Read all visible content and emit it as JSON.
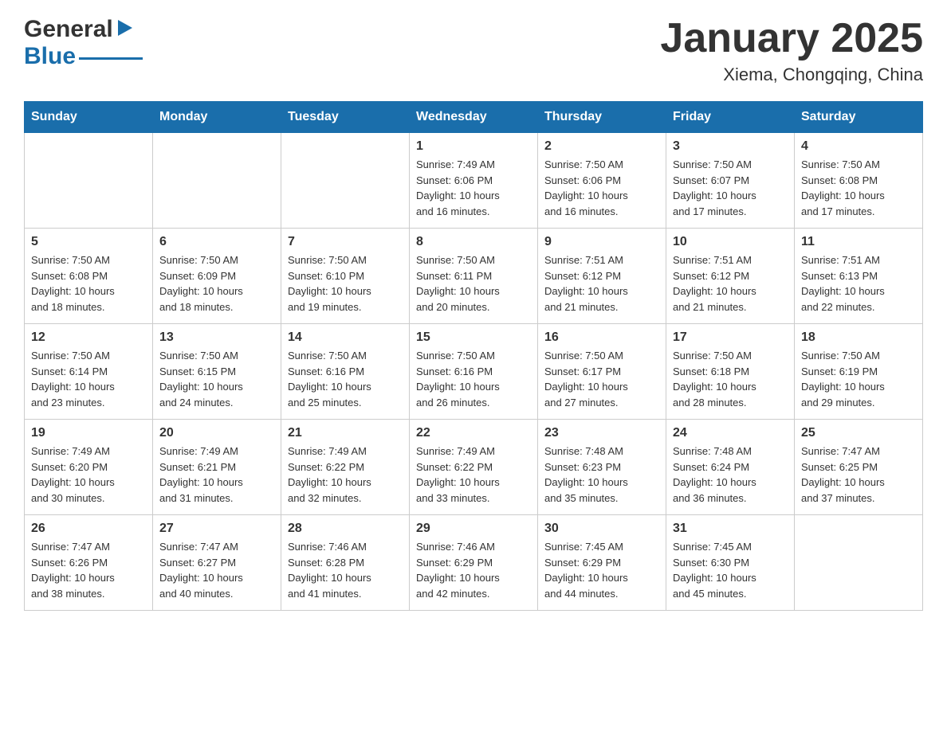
{
  "header": {
    "logo_general": "General",
    "logo_blue": "Blue",
    "title": "January 2025",
    "subtitle": "Xiema, Chongqing, China"
  },
  "days_of_week": [
    "Sunday",
    "Monday",
    "Tuesday",
    "Wednesday",
    "Thursday",
    "Friday",
    "Saturday"
  ],
  "weeks": [
    [
      {
        "day": "",
        "info": ""
      },
      {
        "day": "",
        "info": ""
      },
      {
        "day": "",
        "info": ""
      },
      {
        "day": "1",
        "info": "Sunrise: 7:49 AM\nSunset: 6:06 PM\nDaylight: 10 hours\nand 16 minutes."
      },
      {
        "day": "2",
        "info": "Sunrise: 7:50 AM\nSunset: 6:06 PM\nDaylight: 10 hours\nand 16 minutes."
      },
      {
        "day": "3",
        "info": "Sunrise: 7:50 AM\nSunset: 6:07 PM\nDaylight: 10 hours\nand 17 minutes."
      },
      {
        "day": "4",
        "info": "Sunrise: 7:50 AM\nSunset: 6:08 PM\nDaylight: 10 hours\nand 17 minutes."
      }
    ],
    [
      {
        "day": "5",
        "info": "Sunrise: 7:50 AM\nSunset: 6:08 PM\nDaylight: 10 hours\nand 18 minutes."
      },
      {
        "day": "6",
        "info": "Sunrise: 7:50 AM\nSunset: 6:09 PM\nDaylight: 10 hours\nand 18 minutes."
      },
      {
        "day": "7",
        "info": "Sunrise: 7:50 AM\nSunset: 6:10 PM\nDaylight: 10 hours\nand 19 minutes."
      },
      {
        "day": "8",
        "info": "Sunrise: 7:50 AM\nSunset: 6:11 PM\nDaylight: 10 hours\nand 20 minutes."
      },
      {
        "day": "9",
        "info": "Sunrise: 7:51 AM\nSunset: 6:12 PM\nDaylight: 10 hours\nand 21 minutes."
      },
      {
        "day": "10",
        "info": "Sunrise: 7:51 AM\nSunset: 6:12 PM\nDaylight: 10 hours\nand 21 minutes."
      },
      {
        "day": "11",
        "info": "Sunrise: 7:51 AM\nSunset: 6:13 PM\nDaylight: 10 hours\nand 22 minutes."
      }
    ],
    [
      {
        "day": "12",
        "info": "Sunrise: 7:50 AM\nSunset: 6:14 PM\nDaylight: 10 hours\nand 23 minutes."
      },
      {
        "day": "13",
        "info": "Sunrise: 7:50 AM\nSunset: 6:15 PM\nDaylight: 10 hours\nand 24 minutes."
      },
      {
        "day": "14",
        "info": "Sunrise: 7:50 AM\nSunset: 6:16 PM\nDaylight: 10 hours\nand 25 minutes."
      },
      {
        "day": "15",
        "info": "Sunrise: 7:50 AM\nSunset: 6:16 PM\nDaylight: 10 hours\nand 26 minutes."
      },
      {
        "day": "16",
        "info": "Sunrise: 7:50 AM\nSunset: 6:17 PM\nDaylight: 10 hours\nand 27 minutes."
      },
      {
        "day": "17",
        "info": "Sunrise: 7:50 AM\nSunset: 6:18 PM\nDaylight: 10 hours\nand 28 minutes."
      },
      {
        "day": "18",
        "info": "Sunrise: 7:50 AM\nSunset: 6:19 PM\nDaylight: 10 hours\nand 29 minutes."
      }
    ],
    [
      {
        "day": "19",
        "info": "Sunrise: 7:49 AM\nSunset: 6:20 PM\nDaylight: 10 hours\nand 30 minutes."
      },
      {
        "day": "20",
        "info": "Sunrise: 7:49 AM\nSunset: 6:21 PM\nDaylight: 10 hours\nand 31 minutes."
      },
      {
        "day": "21",
        "info": "Sunrise: 7:49 AM\nSunset: 6:22 PM\nDaylight: 10 hours\nand 32 minutes."
      },
      {
        "day": "22",
        "info": "Sunrise: 7:49 AM\nSunset: 6:22 PM\nDaylight: 10 hours\nand 33 minutes."
      },
      {
        "day": "23",
        "info": "Sunrise: 7:48 AM\nSunset: 6:23 PM\nDaylight: 10 hours\nand 35 minutes."
      },
      {
        "day": "24",
        "info": "Sunrise: 7:48 AM\nSunset: 6:24 PM\nDaylight: 10 hours\nand 36 minutes."
      },
      {
        "day": "25",
        "info": "Sunrise: 7:47 AM\nSunset: 6:25 PM\nDaylight: 10 hours\nand 37 minutes."
      }
    ],
    [
      {
        "day": "26",
        "info": "Sunrise: 7:47 AM\nSunset: 6:26 PM\nDaylight: 10 hours\nand 38 minutes."
      },
      {
        "day": "27",
        "info": "Sunrise: 7:47 AM\nSunset: 6:27 PM\nDaylight: 10 hours\nand 40 minutes."
      },
      {
        "day": "28",
        "info": "Sunrise: 7:46 AM\nSunset: 6:28 PM\nDaylight: 10 hours\nand 41 minutes."
      },
      {
        "day": "29",
        "info": "Sunrise: 7:46 AM\nSunset: 6:29 PM\nDaylight: 10 hours\nand 42 minutes."
      },
      {
        "day": "30",
        "info": "Sunrise: 7:45 AM\nSunset: 6:29 PM\nDaylight: 10 hours\nand 44 minutes."
      },
      {
        "day": "31",
        "info": "Sunrise: 7:45 AM\nSunset: 6:30 PM\nDaylight: 10 hours\nand 45 minutes."
      },
      {
        "day": "",
        "info": ""
      }
    ]
  ]
}
